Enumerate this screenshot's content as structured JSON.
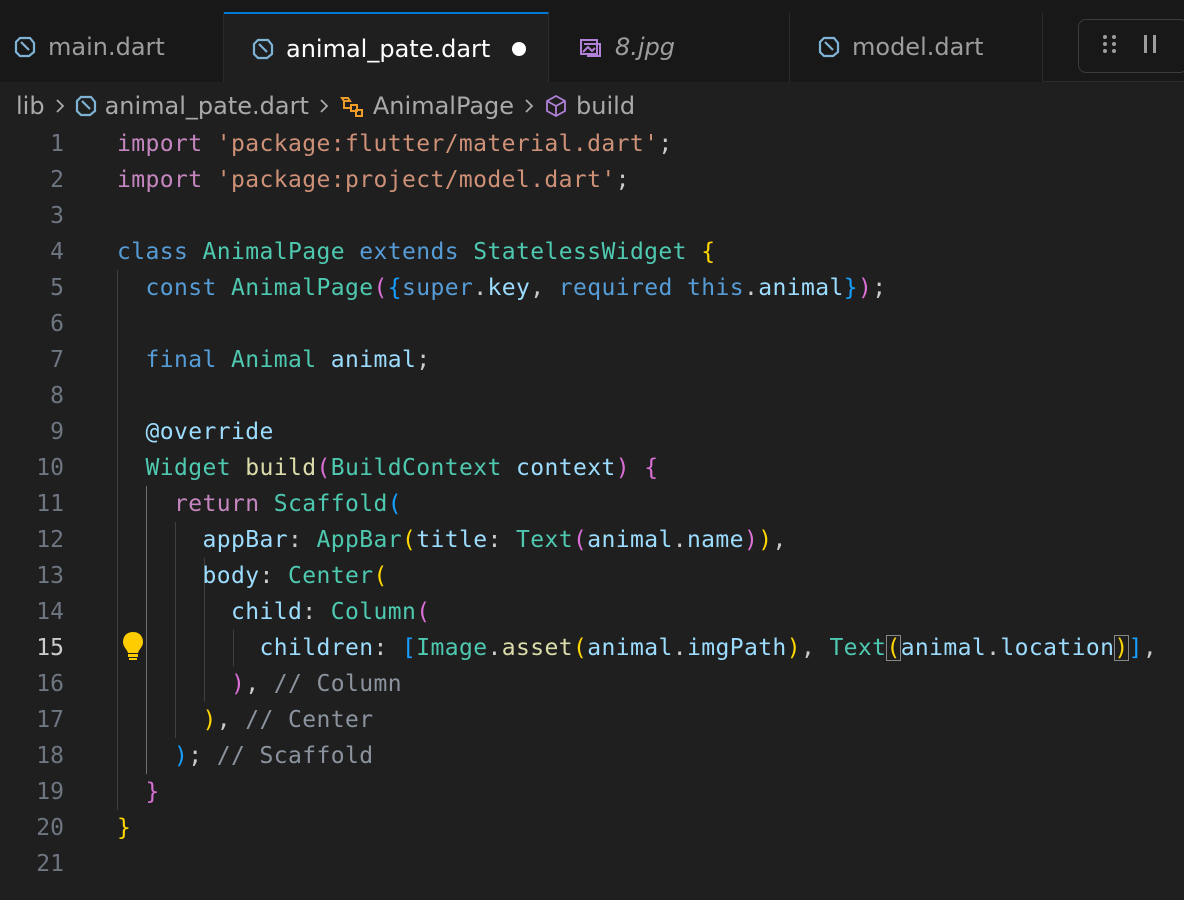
{
  "tabs": [
    {
      "label": "main.dart",
      "icon": "dart-icon",
      "active": false,
      "modified": false
    },
    {
      "label": "animal_pate.dart",
      "icon": "dart-icon",
      "active": true,
      "modified": true
    },
    {
      "label": "8.jpg",
      "icon": "image-icon",
      "active": false,
      "modified": false
    },
    {
      "label": "model.dart",
      "icon": "dart-icon",
      "active": false,
      "modified": false
    }
  ],
  "breadcrumb": {
    "folder": "lib",
    "file": "animal_pate.dart",
    "class": "AnimalPage",
    "method": "build"
  },
  "editor": {
    "current_line": 15,
    "line_numbers": [
      "1",
      "2",
      "3",
      "4",
      "5",
      "6",
      "7",
      "8",
      "9",
      "10",
      "11",
      "12",
      "13",
      "14",
      "15",
      "16",
      "17",
      "18",
      "19",
      "20",
      "21"
    ],
    "code": {
      "l1_kw": "import",
      "l1_str": "'package:flutter/material.dart'",
      "l2_kw": "import",
      "l2_str": "'package:project/model.dart'",
      "l4_class_kw": "class",
      "l4_name": "AnimalPage",
      "l4_extends": "extends",
      "l4_super": "StatelessWidget",
      "l5_const": "const",
      "l5_name": "AnimalPage",
      "l5_super": "super",
      "l5_key": "key",
      "l5_required": "required",
      "l5_this": "this",
      "l5_animal": "animal",
      "l7_final": "final",
      "l7_type": "Animal",
      "l7_var": "animal",
      "l9_annotation": "@override",
      "l10_type": "Widget",
      "l10_fn": "build",
      "l10_param_type": "BuildContext",
      "l10_param": "context",
      "l11_return": "return",
      "l11_class": "Scaffold",
      "l12_prop": "appBar",
      "l12_class": "AppBar",
      "l12_title": "title",
      "l12_text": "Text",
      "l12_obj": "animal",
      "l12_field": "name",
      "l13_prop": "body",
      "l13_class": "Center",
      "l14_prop": "child",
      "l14_class": "Column",
      "l15_prop": "children",
      "l15_image": "Image",
      "l15_asset": "asset",
      "l15_obj": "animal",
      "l15_field": "imgPath",
      "l15_text": "Text",
      "l15_obj2": "animal",
      "l15_field2": "location",
      "l16_comment": "// Column",
      "l17_comment": "// Center",
      "l18_comment": "// Scaffold"
    }
  }
}
